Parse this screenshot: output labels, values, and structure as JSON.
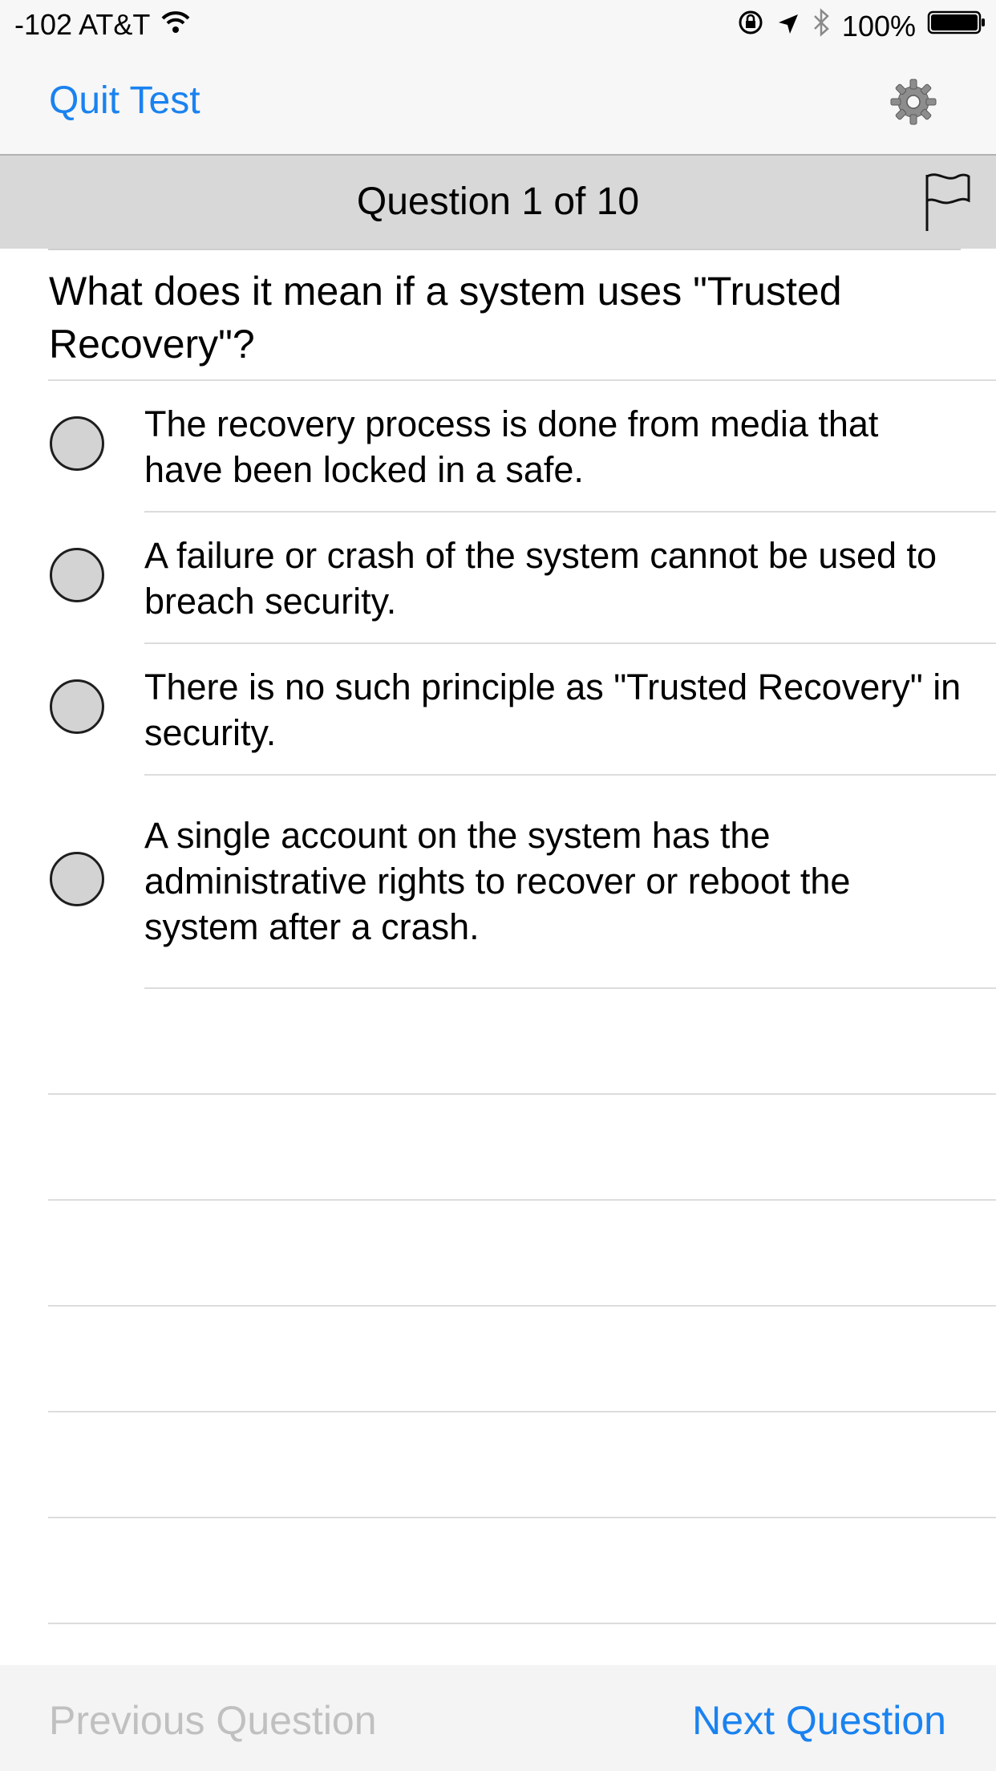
{
  "status_bar": {
    "carrier": "-102 AT&T",
    "battery_percent": "100%",
    "icons": [
      "wifi-icon",
      "orientation-lock-icon",
      "location-arrow-icon",
      "bluetooth-icon",
      "battery-icon"
    ]
  },
  "navbar": {
    "quit_label": "Quit Test",
    "settings_icon": "gear-icon"
  },
  "question_header": {
    "title": "Question 1 of 10",
    "flag_icon": "flag-icon"
  },
  "question": {
    "text": "What does it mean if a system uses \"Trusted Recovery\"?"
  },
  "options": [
    {
      "text": "The recovery process is done from media that have been locked in a safe.",
      "selected": false
    },
    {
      "text": "A failure or crash of the system cannot be used to breach security.",
      "selected": false
    },
    {
      "text": "There is no such principle as \"Trusted Recovery\" in security.",
      "selected": false
    },
    {
      "text": "A single account on the system has the administrative rights to recover or reboot the system after a crash.",
      "selected": false
    }
  ],
  "bottom_bar": {
    "previous_label": "Previous Question",
    "previous_enabled": false,
    "next_label": "Next Question"
  },
  "colors": {
    "accent": "#1a82f0",
    "disabled": "#c0c0c0",
    "header_bg": "#d8d8d8",
    "bar_bg": "#f7f7f7"
  }
}
